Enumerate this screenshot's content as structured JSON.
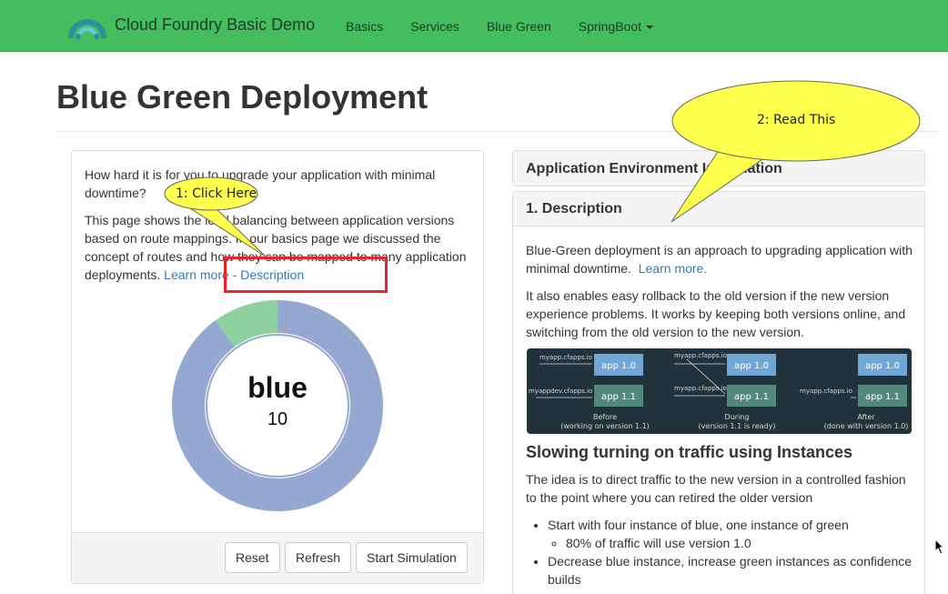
{
  "navbar": {
    "brand": "Cloud Foundry Basic Demo",
    "links": [
      "Basics",
      "Services",
      "Blue Green",
      "SpringBoot"
    ]
  },
  "page": {
    "title": "Blue Green Deployment"
  },
  "left_panel": {
    "intro": "How hard it is for you to upgrade your application with minimal downtime?",
    "body": "This page shows the load balancing between application versions based on route mappings. In our basics page we discussed the concept of routes and how they can be mapped to many application deployments.",
    "learn_more_link": "Learn more - Description",
    "donut": {
      "label": "blue",
      "value": "10",
      "blue_fraction": 0.9,
      "green_fraction": 0.1,
      "blue_color": "#94a8d2",
      "green_color": "#8fd19e"
    },
    "buttons": {
      "reset": "Reset",
      "refresh": "Refresh",
      "start": "Start Simulation"
    }
  },
  "right_panel": {
    "env_heading": "Application Environment Information",
    "desc_heading": "1. Description",
    "para1": "Blue-Green deployment is an approach to upgrading application with minimal downtime.",
    "para1_link": "Learn more.",
    "para2": "It also enables easy rollback to the old version if the new version experience problems. It works by keeping both versions online, and switching from the old version to the new version.",
    "diagram": {
      "before": {
        "route1": "myapp.cfapps.io",
        "route2": "myappdev.cfapps.io",
        "app1": "app 1.0",
        "app2": "app 1.1",
        "caption1": "Before",
        "caption2": "(working on version 1.1)"
      },
      "during": {
        "route1": "myapp.cfapps.io",
        "route2": "myapp.cfapps.io",
        "app1": "app 1.0",
        "app2": "app 1.1",
        "caption1": "During",
        "caption2": "(version 1.1 is ready)"
      },
      "after": {
        "route2": "myapp.cfapps.io",
        "app1": "app 1.0",
        "app2": "app 1.1",
        "caption1": "After",
        "caption2": "(done with version 1.0)"
      }
    },
    "subheading": "Slowing turning on traffic using Instances",
    "para3": "The idea is to direct traffic to the new version in a controlled fashion to the point where you can retired the older version",
    "bullets": [
      "Start with four instance of blue, one instance of green",
      "80% of traffic will use version 1.0",
      "Decrease blue instance, increase green instances as confidence builds"
    ]
  },
  "callouts": {
    "click": "1: Click Here",
    "read": "2: Read This"
  }
}
